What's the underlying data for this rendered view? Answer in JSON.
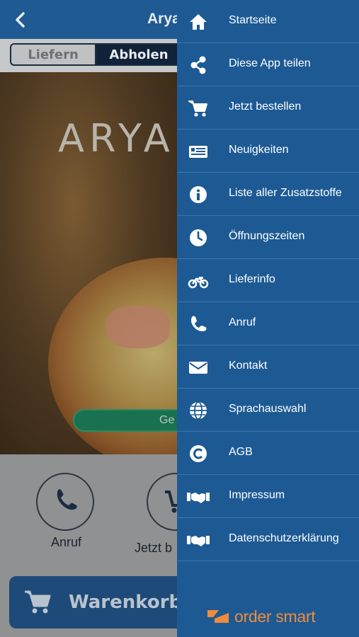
{
  "header": {
    "title": "Arya"
  },
  "segment": {
    "deliver": "Liefern",
    "pickup": "Abholen"
  },
  "hero": {
    "name": "ARYAN",
    "status": "Ge"
  },
  "actions": {
    "call": "Anruf",
    "order": "Jetzt b"
  },
  "cart": {
    "label": "Warenkorb"
  },
  "menu": {
    "items": [
      {
        "label": "Startseite",
        "icon": "home-icon"
      },
      {
        "label": "Diese App teilen",
        "icon": "share-icon"
      },
      {
        "label": "Jetzt bestellen",
        "icon": "cart-icon"
      },
      {
        "label": "Neuigkeiten",
        "icon": "news-icon"
      },
      {
        "label": "Liste aller Zusatzstoffe",
        "icon": "info-icon"
      },
      {
        "label": "Öffnungszeiten",
        "icon": "clock-icon"
      },
      {
        "label": "Lieferinfo",
        "icon": "motorbike-icon"
      },
      {
        "label": "Anruf",
        "icon": "phone-icon"
      },
      {
        "label": "Kontakt",
        "icon": "envelope-icon"
      },
      {
        "label": "Sprachauswahl",
        "icon": "globe-icon"
      },
      {
        "label": "AGB",
        "icon": "copyright-icon"
      },
      {
        "label": "Impressum",
        "icon": "handshake-icon"
      },
      {
        "label": "Datenschutzerklärung",
        "icon": "handshake-icon"
      }
    ]
  },
  "brand": {
    "name": "order smart"
  },
  "colors": {
    "drawer": "#1d5a94",
    "brand": "#ef8b3d",
    "open": "#19714f"
  }
}
